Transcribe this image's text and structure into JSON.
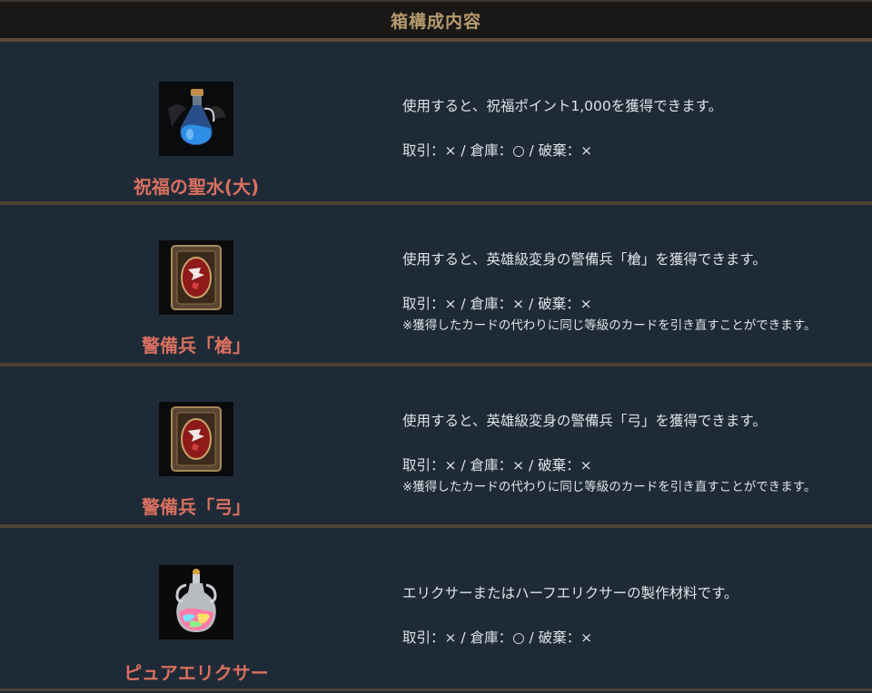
{
  "header": {
    "title": "箱構成内容"
  },
  "items": [
    {
      "name": "祝福の聖水(大)",
      "icon": "blue-potion-icon",
      "description": "使用すると、祝福ポイント1,000を獲得できます。",
      "trade": "取引：× / 倉庫：○ / 破棄：×",
      "note": ""
    },
    {
      "name": "警備兵「槍」",
      "icon": "card-icon",
      "description": "使用すると、英雄級変身の警備兵「槍」を獲得できます。",
      "trade": "取引：× / 倉庫：× / 破棄：×",
      "note": "※獲得したカードの代わりに同じ等級のカードを引き直すことができます。"
    },
    {
      "name": "警備兵「弓」",
      "icon": "card-icon",
      "description": "使用すると、英雄級変身の警備兵「弓」を獲得できます。",
      "trade": "取引：× / 倉庫：× / 破棄：×",
      "note": "※獲得したカードの代わりに同じ等級のカードを引き直すことができます。"
    },
    {
      "name": "ピュアエリクサー",
      "icon": "elixir-icon",
      "description": "エリクサーまたはハーフエリクサーの製作材料です。",
      "trade": "取引：× / 倉庫：○ / 破棄：×",
      "note": ""
    }
  ],
  "colors": {
    "background": "#1f2a37",
    "header_bg": "#1a1816",
    "header_text": "#b59a6e",
    "item_name": "#d9705f",
    "divider": "#4e4236"
  }
}
